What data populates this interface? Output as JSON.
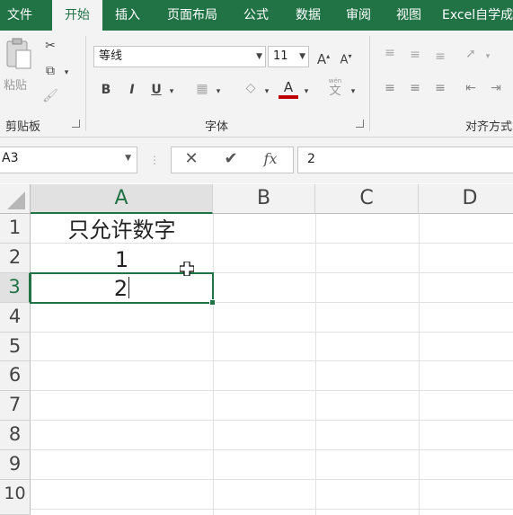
{
  "menu": {
    "tabs": [
      {
        "label": "文件"
      },
      {
        "label": "开始"
      },
      {
        "label": "插入"
      },
      {
        "label": "页面布局"
      },
      {
        "label": "公式"
      },
      {
        "label": "数据"
      },
      {
        "label": "审阅"
      },
      {
        "label": "视图"
      },
      {
        "label": "Excel自学成"
      }
    ],
    "active_tab": "开始"
  },
  "ribbon": {
    "clipboard": {
      "paste_label": "粘贴",
      "group_label": "剪贴板"
    },
    "font": {
      "font_name": "等线",
      "font_size": "11",
      "bold": "B",
      "italic": "I",
      "underline": "U",
      "font_color": "#c00000",
      "wen": "wén",
      "group_label": "字体"
    },
    "alignment": {
      "group_label": "对齐方式"
    }
  },
  "formula_bar": {
    "name_box": "A3",
    "fx": "fx",
    "content": "2"
  },
  "sheet": {
    "columns": [
      "A",
      "B",
      "C",
      "D"
    ],
    "selected_column": "A",
    "rows": [
      "1",
      "2",
      "3",
      "4",
      "5",
      "6",
      "7",
      "8",
      "9",
      "10"
    ],
    "selected_row": "3",
    "active_cell": "A3",
    "cells": {
      "A1": "只允许数字",
      "A2": "1",
      "A3": "2"
    }
  },
  "colors": {
    "accent": "#217346"
  }
}
